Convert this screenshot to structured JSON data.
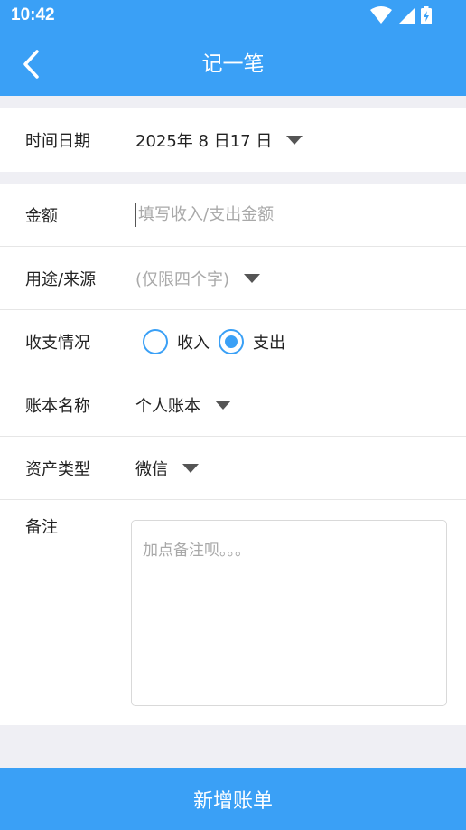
{
  "status_bar": {
    "time": "10:42",
    "icons": [
      "wifi-icon",
      "signal-icon",
      "battery-icon"
    ]
  },
  "app_bar": {
    "back_icon": "chevron-left-icon",
    "title": "记一笔"
  },
  "form": {
    "date": {
      "label": "时间日期",
      "value": "2025年 8 日17 日"
    },
    "amount": {
      "label": "金额",
      "placeholder": "填写收入/支出金额",
      "value": ""
    },
    "purpose": {
      "label": "用途/来源",
      "placeholder": "(仅限四个字)"
    },
    "type": {
      "label": "收支情况",
      "options": [
        {
          "label": "收入",
          "selected": false
        },
        {
          "label": "支出",
          "selected": true
        }
      ]
    },
    "book": {
      "label": "账本名称",
      "value": "个人账本"
    },
    "asset": {
      "label": "资产类型",
      "value": "微信"
    },
    "notes": {
      "label": "备注",
      "placeholder": "加点备注呗。。。"
    }
  },
  "submit": {
    "label": "新增账单"
  },
  "colors": {
    "primary": "#3aa0f6",
    "background": "#efeff4",
    "placeholder": "#a9a9a9"
  }
}
